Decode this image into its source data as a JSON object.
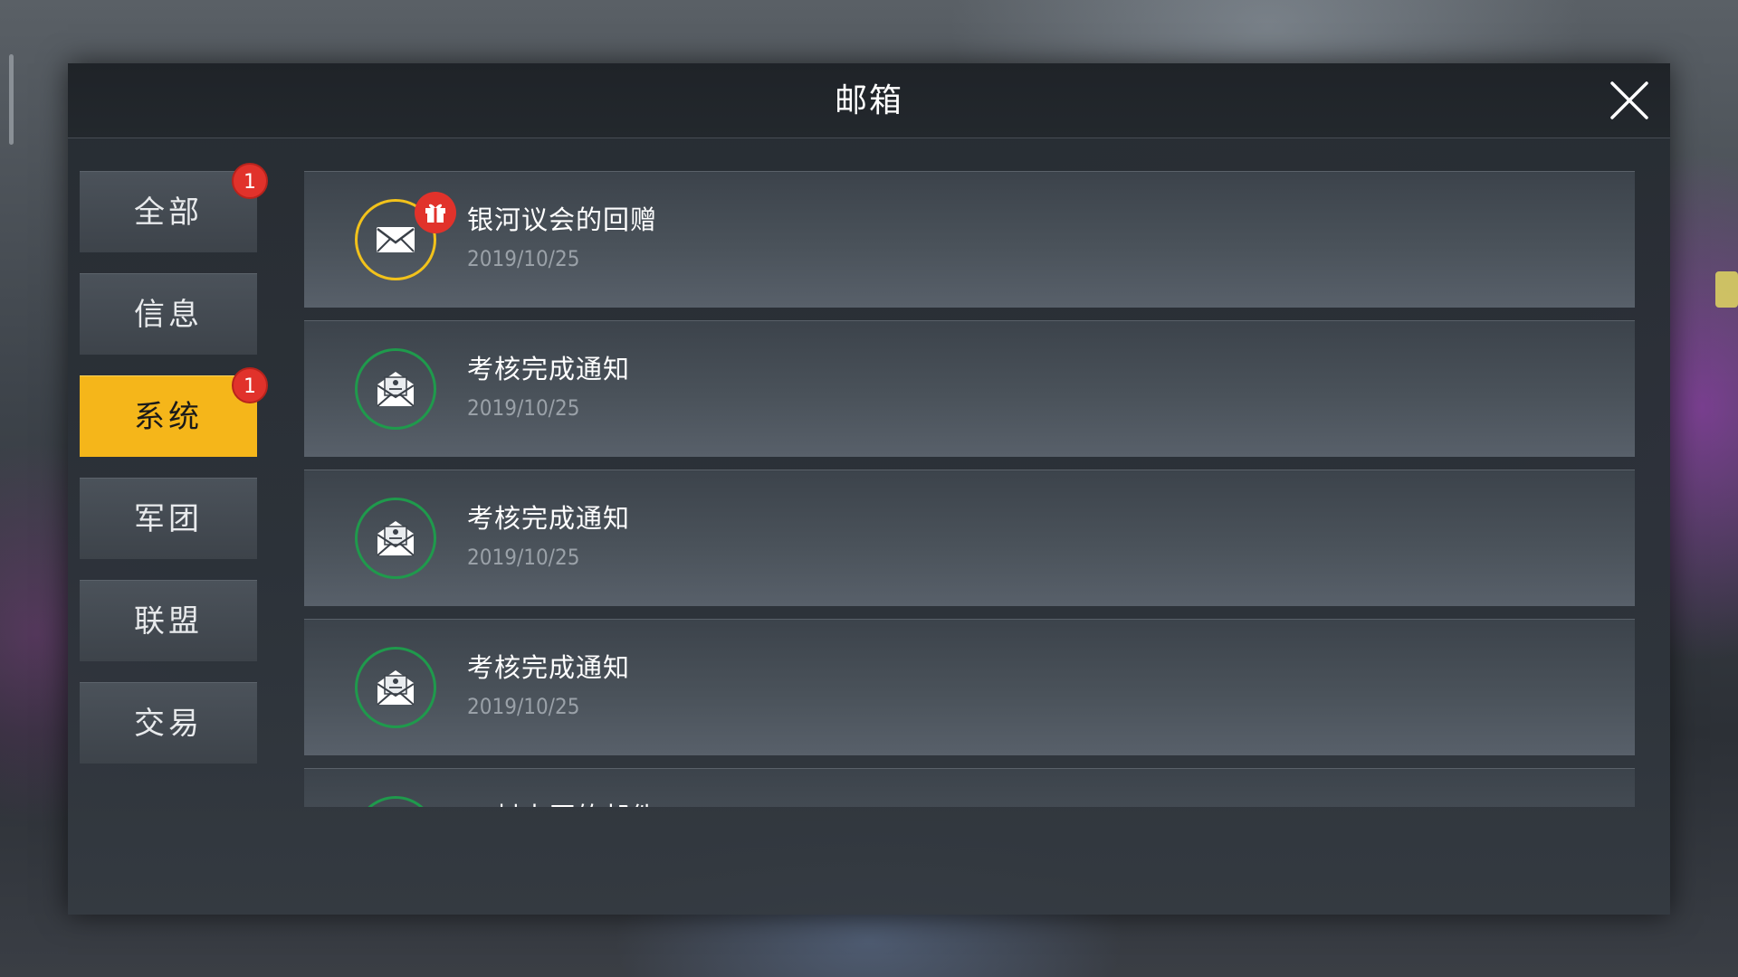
{
  "mailbox": {
    "title": "邮箱"
  },
  "sidebar": {
    "items": [
      {
        "label": "全部",
        "badge": "1",
        "active": false
      },
      {
        "label": "信息",
        "badge": "",
        "active": false
      },
      {
        "label": "系统",
        "badge": "1",
        "active": true
      },
      {
        "label": "军团",
        "badge": "",
        "active": false
      },
      {
        "label": "联盟",
        "badge": "",
        "active": false
      },
      {
        "label": "交易",
        "badge": "",
        "active": false
      }
    ]
  },
  "mails": [
    {
      "subject": "银河议会的回赠",
      "date": "2019/10/25",
      "icon": "envelope-icon",
      "has_gift": true,
      "ring_color": "#f2c21b"
    },
    {
      "subject": "考核完成通知",
      "date": "2019/10/25",
      "icon": "open-letter-icon",
      "has_gift": false,
      "ring_color": "#1f9a4c"
    },
    {
      "subject": "考核完成通知",
      "date": "2019/10/25",
      "icon": "open-letter-icon",
      "has_gift": false,
      "ring_color": "#1f9a4c"
    },
    {
      "subject": "考核完成通知",
      "date": "2019/10/25",
      "icon": "open-letter-icon",
      "has_gift": false,
      "ring_color": "#1f9a4c"
    },
    {
      "subject": "一封来历的邮件",
      "date": "",
      "icon": "open-letter-icon",
      "has_gift": false,
      "ring_color": "#1f9a4c"
    }
  ],
  "colors": {
    "active_tab": "#f5b61a",
    "badge": "#e1322b",
    "gift_ring": "#f2c21b",
    "read_ring": "#1f9a4c"
  }
}
